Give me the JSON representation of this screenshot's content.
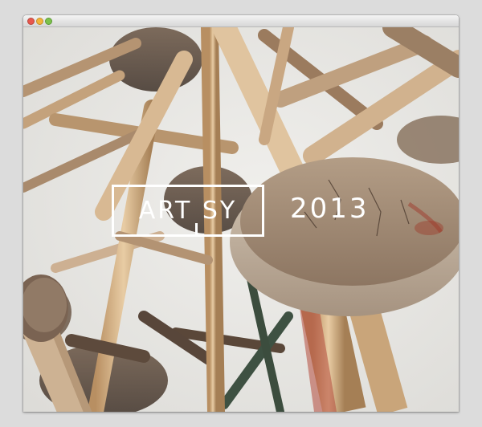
{
  "window": {
    "controls": [
      "close",
      "minimize",
      "zoom"
    ]
  },
  "hero": {
    "logo_text": "ART SY",
    "year": "2013"
  },
  "colors": {
    "background": "#dcdcdc",
    "photo_wood": "#c9a77e",
    "logo": "#ffffff"
  }
}
